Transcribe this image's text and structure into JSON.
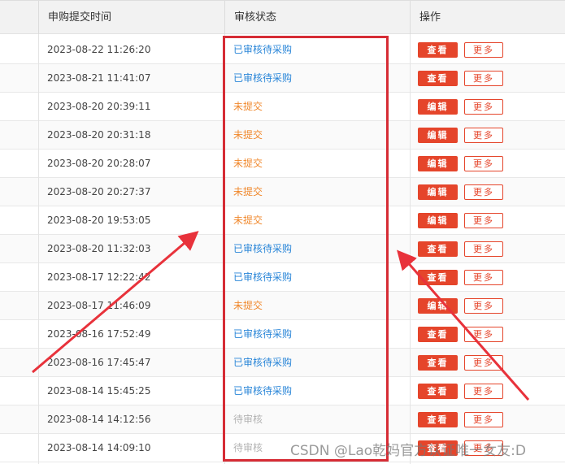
{
  "table": {
    "headers": {
      "submit_time": "申购提交时间",
      "review_status": "审核状态",
      "actions": "操作"
    },
    "rows": [
      {
        "time": "2023-08-22 11:26:20",
        "status": "已审核待采购",
        "status_type": "approved",
        "primary_action": "查看",
        "more": "更多"
      },
      {
        "time": "2023-08-21 11:41:07",
        "status": "已审核待采购",
        "status_type": "approved",
        "primary_action": "查看",
        "more": "更多"
      },
      {
        "time": "2023-08-20 20:39:11",
        "status": "未提交",
        "status_type": "unsubmitted",
        "primary_action": "编辑",
        "more": "更多"
      },
      {
        "time": "2023-08-20 20:31:18",
        "status": "未提交",
        "status_type": "unsubmitted",
        "primary_action": "编辑",
        "more": "更多"
      },
      {
        "time": "2023-08-20 20:28:07",
        "status": "未提交",
        "status_type": "unsubmitted",
        "primary_action": "编辑",
        "more": "更多"
      },
      {
        "time": "2023-08-20 20:27:37",
        "status": "未提交",
        "status_type": "unsubmitted",
        "primary_action": "编辑",
        "more": "更多"
      },
      {
        "time": "2023-08-20 19:53:05",
        "status": "未提交",
        "status_type": "unsubmitted",
        "primary_action": "编辑",
        "more": "更多"
      },
      {
        "time": "2023-08-20 11:32:03",
        "status": "已审核待采购",
        "status_type": "approved",
        "primary_action": "查看",
        "more": "更多"
      },
      {
        "time": "2023-08-17 12:22:42",
        "status": "已审核待采购",
        "status_type": "approved",
        "primary_action": "查看",
        "more": "更多"
      },
      {
        "time": "2023-08-17 11:46:09",
        "status": "未提交",
        "status_type": "unsubmitted",
        "primary_action": "编辑",
        "more": "更多"
      },
      {
        "time": "2023-08-16 17:52:49",
        "status": "已审核待采购",
        "status_type": "approved",
        "primary_action": "查看",
        "more": "更多"
      },
      {
        "time": "2023-08-16 17:45:47",
        "status": "已审核待采购",
        "status_type": "approved",
        "primary_action": "查看",
        "more": "更多"
      },
      {
        "time": "2023-08-14 15:45:25",
        "status": "已审核待采购",
        "status_type": "approved",
        "primary_action": "查看",
        "more": "更多"
      },
      {
        "time": "2023-08-14 14:12:56",
        "status": "待审核",
        "status_type": "pending",
        "primary_action": "查看",
        "more": "更多"
      },
      {
        "time": "2023-08-14 14:09:10",
        "status": "待审核",
        "status_type": "pending",
        "primary_action": "查看",
        "more": "更多"
      }
    ]
  },
  "watermark": "CSDN @Lao乾妈官方认证唯一女友:D",
  "colors": {
    "approved": "#2a86d8",
    "unsubmitted": "#f0882c",
    "pending": "#b3b3b3",
    "button_red": "#e5452b",
    "annotation_red": "#d62c35"
  }
}
